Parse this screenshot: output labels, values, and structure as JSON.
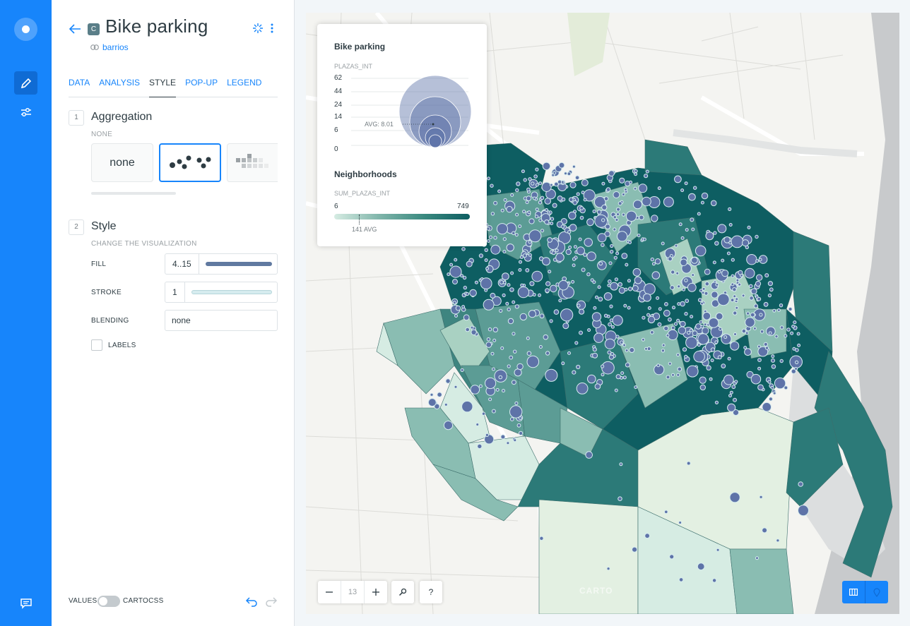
{
  "layer": {
    "title": "Bike parking",
    "badge": "C",
    "source": "barrios"
  },
  "tabs": [
    {
      "label": "DATA"
    },
    {
      "label": "ANALYSIS"
    },
    {
      "label": "STYLE",
      "active": true
    },
    {
      "label": "POP-UP"
    },
    {
      "label": "LEGEND"
    }
  ],
  "aggregation": {
    "number": "1",
    "title": "Aggregation",
    "subtitle": "NONE",
    "options": [
      {
        "label": "none"
      },
      {
        "label": "points",
        "selected": true
      },
      {
        "label": "squares"
      }
    ]
  },
  "style": {
    "number": "2",
    "title": "Style",
    "subtitle": "CHANGE THE VISUALIZATION",
    "fill": {
      "label": "FILL",
      "value": "4..15",
      "color": "#6079A0"
    },
    "stroke": {
      "label": "STROKE",
      "value": "1",
      "color": "#D6ECEF"
    },
    "blending": {
      "label": "BLENDING",
      "value": "none"
    },
    "labels": {
      "label": "LABELS",
      "checked": false
    }
  },
  "footer": {
    "values_label": "VALUES",
    "cartocss_label": "CARTOCSS"
  },
  "legend": {
    "bubble": {
      "title": "Bike parking",
      "field": "PLAZAS_INT",
      "ticks": [
        "62",
        "44",
        "24",
        "14",
        "6",
        "0"
      ],
      "avg_label": "AVG: 8.01",
      "color": "#5E73A8"
    },
    "choropleth": {
      "title": "Neighborhoods",
      "field": "SUM_PLAZAS_INT",
      "min": "6",
      "max": "749",
      "avg_label": "141 AVG"
    }
  },
  "map": {
    "zoom": "13",
    "zoom_out": "−",
    "zoom_in": "+",
    "search_icon": "search-icon",
    "help": "?",
    "attribution": "CARTO"
  },
  "colors": {
    "accent": "#1785FB",
    "choropleth_dark": "#0E5E62",
    "choropleth_light": "#E3F0E2",
    "bubble_fill": "#5E73A8"
  }
}
